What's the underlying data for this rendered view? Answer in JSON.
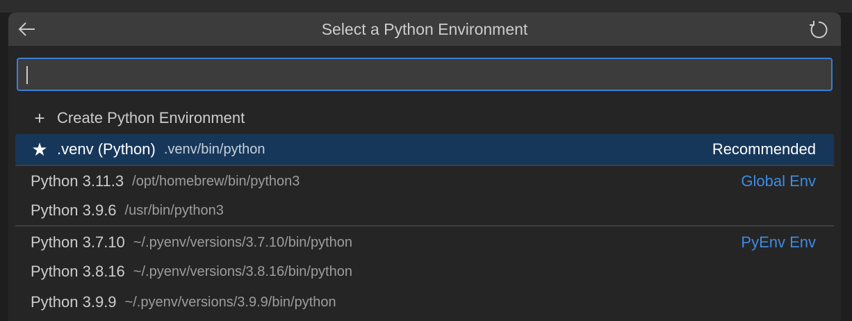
{
  "title": "Select a Python Environment",
  "search": {
    "value": "",
    "placeholder": ""
  },
  "create_label": "Create Python Environment",
  "items": [
    {
      "label": ".venv (Python)",
      "path": ".venv/bin/python",
      "tag": "Recommended"
    },
    {
      "label": "Python 3.11.3",
      "path": "/opt/homebrew/bin/python3",
      "tag": "Global Env"
    },
    {
      "label": "Python 3.9.6",
      "path": "/usr/bin/python3"
    },
    {
      "label": "Python 3.7.10",
      "path": "~/.pyenv/versions/3.7.10/bin/python",
      "tag": "PyEnv Env"
    },
    {
      "label": "Python 3.8.16",
      "path": "~/.pyenv/versions/3.8.16/bin/python"
    },
    {
      "label": "Python 3.9.9",
      "path": "~/.pyenv/versions/3.9.9/bin/python"
    }
  ],
  "colors": {
    "accent": "#3a7fd5",
    "selected": "#17375a",
    "tag": "#3f8be3"
  }
}
